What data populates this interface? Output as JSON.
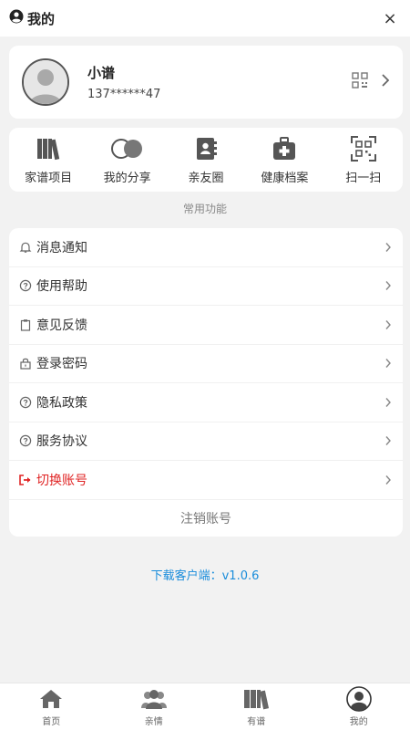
{
  "header": {
    "title": "我的",
    "close_label": "×"
  },
  "profile": {
    "name": "小谱",
    "phone": "137******47"
  },
  "quick_actions": [
    {
      "label": "家谱项目",
      "icon": "books-icon"
    },
    {
      "label": "我的分享",
      "icon": "share-toggle-icon"
    },
    {
      "label": "亲友圈",
      "icon": "contact-book-icon"
    },
    {
      "label": "健康档案",
      "icon": "medical-kit-icon"
    },
    {
      "label": "扫一扫",
      "icon": "scan-icon"
    }
  ],
  "section_label": "常用功能",
  "menu": [
    {
      "label": "消息通知",
      "icon": "bell-icon"
    },
    {
      "label": "使用帮助",
      "icon": "help-icon"
    },
    {
      "label": "意见反馈",
      "icon": "clipboard-icon"
    },
    {
      "label": "登录密码",
      "icon": "lock-icon"
    },
    {
      "label": "隐私政策",
      "icon": "help-icon"
    },
    {
      "label": "服务协议",
      "icon": "help-icon"
    },
    {
      "label": "切换账号",
      "icon": "logout-icon"
    }
  ],
  "cancel_account_label": "注销账号",
  "download_text": "下载客户端：v1.0.6",
  "tabs": [
    {
      "label": "首页",
      "icon": "home-icon"
    },
    {
      "label": "亲情",
      "icon": "people-icon"
    },
    {
      "label": "有谱",
      "icon": "books-icon"
    },
    {
      "label": "我的",
      "icon": "avatar-icon"
    }
  ],
  "colors": {
    "accent_link": "#1a8ddb",
    "danger": "#e02424",
    "background": "#f2f2f2"
  }
}
